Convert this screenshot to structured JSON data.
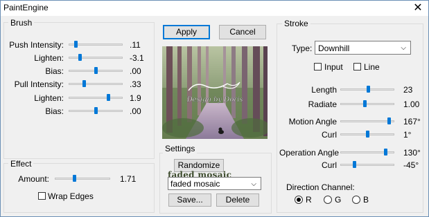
{
  "window": {
    "title": "PaintEngine",
    "close_glyph": "✕"
  },
  "brush": {
    "legend": "Brush",
    "rows": [
      {
        "label": "Push Intensity:",
        "value": ".11",
        "level": 0.11
      },
      {
        "label": "Lighten:",
        "value": "-3.1",
        "level": 0.19
      },
      {
        "label": "Bias:",
        "value": ".00",
        "level": 0.5
      },
      {
        "label": "Pull Intensity:",
        "value": ".33",
        "level": 0.28
      },
      {
        "label": "Lighten:",
        "value": "1.9",
        "level": 0.76
      },
      {
        "label": "Bias:",
        "value": ".00",
        "level": 0.5
      }
    ]
  },
  "effect": {
    "legend": "Effect",
    "amount_label": "Amount:",
    "amount_value": "1.71",
    "amount_level": 0.34,
    "wrap_edges_label": "Wrap Edges",
    "wrap_edges_checked": false
  },
  "actions": {
    "apply_label": "Apply",
    "cancel_label": "Cancel"
  },
  "preview": {
    "watermark": "Design by Doris"
  },
  "settings": {
    "legend": "Settings",
    "randomize_label": "Randomize",
    "preset_watermark": "faded mosaic",
    "preset_value": "faded mosaic",
    "save_label": "Save...",
    "delete_label": "Delete"
  },
  "stroke": {
    "legend": "Stroke",
    "type_label": "Type:",
    "type_value": "Downhill",
    "input_label": "Input",
    "input_checked": false,
    "line_label": "Line",
    "line_checked": false,
    "rows": [
      {
        "label": "Length",
        "value": "23",
        "level": 0.52
      },
      {
        "label": "Radiate",
        "value": "1.00",
        "level": 0.45
      },
      {
        "label": "Motion Angle",
        "value": "167°",
        "level": 0.93
      },
      {
        "label": "Curl",
        "value": "1°",
        "level": 0.5
      },
      {
        "label": "Operation Angle",
        "value": "130°",
        "level": 0.86
      },
      {
        "label": "Curl",
        "value": "-45°",
        "level": 0.25
      }
    ],
    "direction_label": "Direction Channel:",
    "channels": [
      {
        "label": "R",
        "selected": true
      },
      {
        "label": "G",
        "selected": false
      },
      {
        "label": "B",
        "selected": false
      }
    ]
  },
  "colors": {
    "accent": "#0078d7",
    "window_bg": "#f0f0f0"
  }
}
